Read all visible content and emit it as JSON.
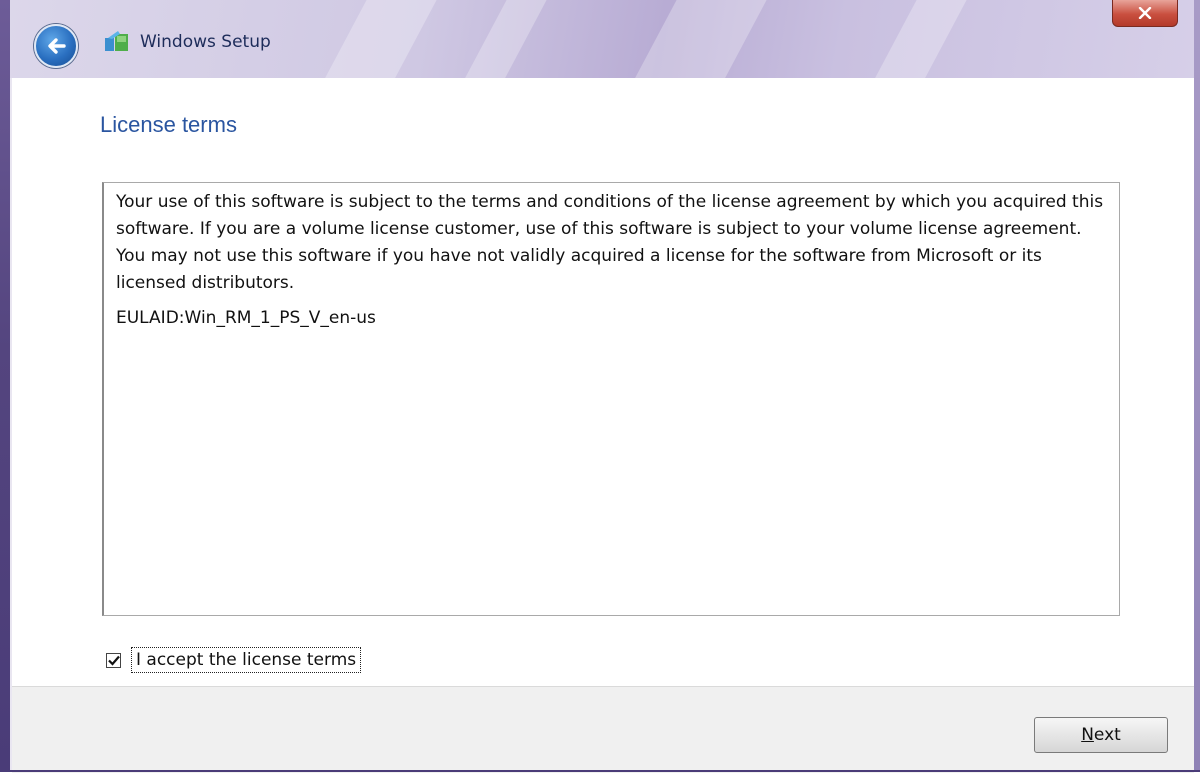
{
  "window": {
    "title": "Windows Setup"
  },
  "page": {
    "title": "License terms"
  },
  "license": {
    "paragraph": "Your use of this software is subject to the terms and conditions of the license agreement by which you acquired this software.  If you are a volume license customer, use of this software is subject to your volume license agreement.  You may not use this software if you have not validly acquired a license for the software from Microsoft or its licensed distributors.",
    "eula_id": "EULAID:Win_RM_1_PS_V_en-us"
  },
  "accept": {
    "checked": true,
    "label": "I accept the license terms"
  },
  "footer": {
    "next_label_accel": "N",
    "next_label_rest": "ext"
  },
  "icons": {
    "back": "back-arrow-icon",
    "setup": "windows-setup-icon",
    "close": "close-icon",
    "check": "checkmark-icon"
  },
  "colors": {
    "title_text": "#2a55a0",
    "frame": "#54457f",
    "close_button": "#c94f3f"
  }
}
